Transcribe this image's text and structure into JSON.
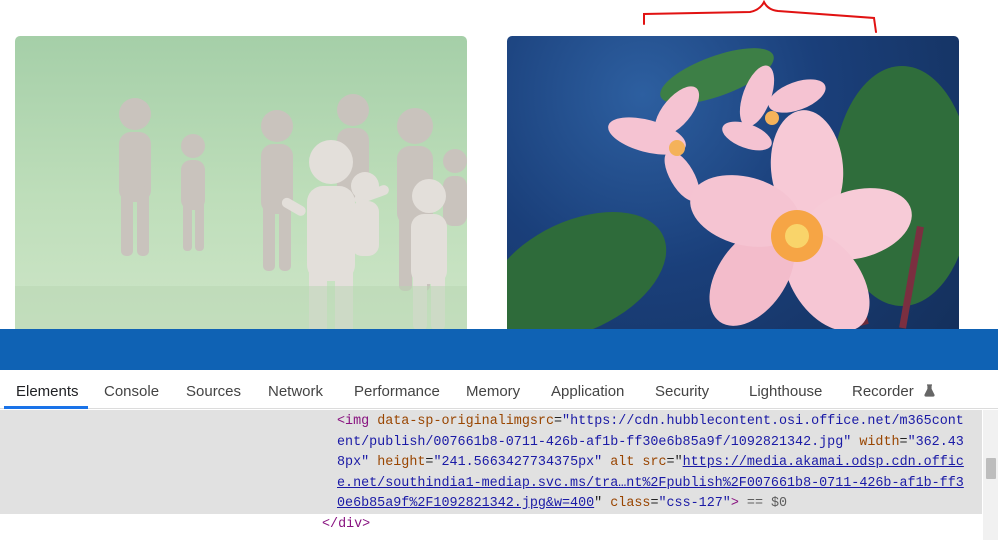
{
  "devtools": {
    "tabs": [
      {
        "label": "Elements"
      },
      {
        "label": "Console"
      },
      {
        "label": "Sources"
      },
      {
        "label": "Network"
      },
      {
        "label": "Performance"
      },
      {
        "label": "Memory"
      },
      {
        "label": "Application"
      },
      {
        "label": "Security"
      },
      {
        "label": "Lighthouse"
      },
      {
        "label": "Recorder"
      }
    ],
    "active_tab": "Elements",
    "code": {
      "tag_open": "<img",
      "attr1_name": "data-sp-originalimgsrc",
      "attr1_value_a": "\"https://cdn.hubblecontent.osi.office.net/m365cont",
      "attr1_value_b": "ent/publish/007661b8-0711-426b-af1b-ff30e6b85a9f/1092821342.jpg\"",
      "attr2_name": "width",
      "attr2_value_a": "\"362.43",
      "attr2_value_b": "8px\"",
      "attr3_name": "height",
      "attr3_value": "\"241.5663427734375px\"",
      "attr4_name": "alt",
      "attr5_name": "src",
      "src_link_a": "https://media.akamai.odsp.cdn.offic",
      "src_link_b": "e.net/southindia1-mediap.svc.ms/tra…nt%2Fpublish%2F007661b8-0711-426b-af1b-ff3",
      "src_link_c": "0e6b85a9f%2F1092821342.jpg&w=400",
      "attr6_name": "class",
      "attr6_value": "\"css-127\"",
      "tag_end": ">",
      "console_ref": "== $0",
      "close_tag": "</div>"
    }
  },
  "colors": {
    "band": "#0f62b4",
    "annotation": "#e11212",
    "tab_indicator": "#1a73e8"
  }
}
